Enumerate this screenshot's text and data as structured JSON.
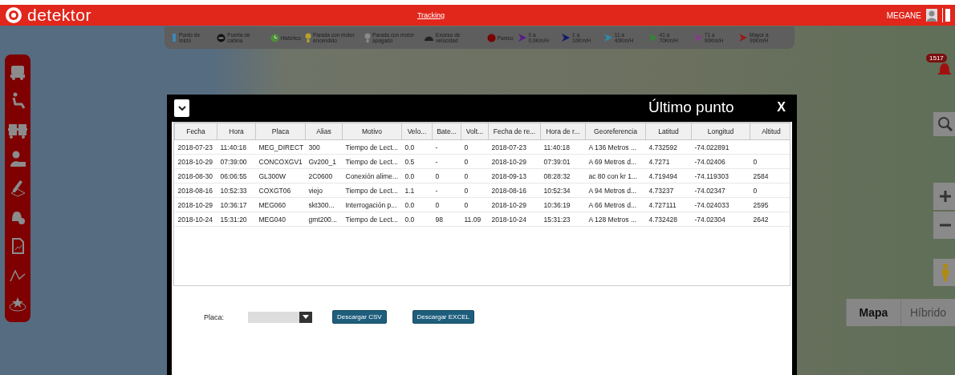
{
  "header": {
    "logo": "detektor",
    "nav_link": "Tracking",
    "user": "MEGANE"
  },
  "legend": [
    {
      "label": "Punto de Inicio",
      "kind": "pin",
      "color": "#3f86b8"
    },
    {
      "label": "Puerta de cabina",
      "kind": "door",
      "color": "#111111"
    },
    {
      "label": "Histórico",
      "kind": "clock",
      "color": "#4f8f3a"
    },
    {
      "label": "Parada con motor encendido",
      "kind": "bulb",
      "color": "#b8a030"
    },
    {
      "label": "Parada con motor apagado",
      "kind": "bulb",
      "color": "#8a8a8a"
    },
    {
      "label": "Exceso de velocidad",
      "kind": "gauge",
      "color": "#222222"
    },
    {
      "label": "Panico",
      "kind": "dot",
      "color": "#7a0000"
    },
    {
      "label": "0 a 0,9Km/H",
      "kind": "arrow",
      "color": "#5a1a8a"
    },
    {
      "label": "1 a 10Km/H",
      "kind": "arrow",
      "color": "#101a6a"
    },
    {
      "label": "11 a 40Km/H",
      "kind": "arrow",
      "color": "#2b8bab"
    },
    {
      "label": "41 a 70Km/H",
      "kind": "arrow",
      "color": "#2f8a2f"
    },
    {
      "label": "71 a 90Km/H",
      "kind": "arrow",
      "color": "#8a3a8a"
    },
    {
      "label": "Mayor a 90Km/H",
      "kind": "arrow",
      "color": "#9a1a1a"
    }
  ],
  "map_controls": {
    "alert_count": "1517",
    "map_types": [
      {
        "label": "Mapa",
        "selected": true
      },
      {
        "label": "Híbrido",
        "selected": false
      }
    ]
  },
  "dialog": {
    "title": "Último punto",
    "close": "X",
    "table": {
      "columns": [
        "Fecha",
        "Hora",
        "Placa",
        "Alias",
        "Motivo",
        "Velo...",
        "Bate...",
        "Volt...",
        "Fecha de re...",
        "Hora de r...",
        "Georeferencia",
        "Latitud",
        "Longitud",
        "Altitud"
      ],
      "rows": [
        [
          "2018-07-23",
          "11:40:18",
          "MEG_DIRECT",
          "300",
          "Tiempo de Lect...",
          "0.0",
          "-",
          "0",
          "2018-07-23",
          "11:40:18",
          "A 136 Metros ...",
          "4.732592",
          "-74.022891",
          null
        ],
        [
          "2018-10-29",
          "07:39:00",
          "CONCOXGV1",
          "Gv200_1",
          "Tiempo de Lect...",
          "0.5",
          "-",
          "0",
          "2018-10-29",
          "07:39:01",
          "A 69 Metros d...",
          "4.7271",
          "-74.02406",
          "0"
        ],
        [
          "2018-08-30",
          "06:06:55",
          "GL300W",
          "2C0600",
          "Conexión alime...",
          "0.0",
          "0",
          "0",
          "2018-09-13",
          "08:28:32",
          "ac 80 con kr 1...",
          "4.719494",
          "-74.119303",
          "2584"
        ],
        [
          "2018-08-16",
          "10:52:33",
          "COXGT06",
          "viejo",
          "Tiempo de Lect...",
          "1.1",
          "-",
          "0",
          "2018-08-16",
          "10:52:34",
          "A 94 Metros d...",
          "4.73237",
          "-74.02347",
          "0"
        ],
        [
          "2018-10-29",
          "10:36:17",
          "MEG060",
          "skt300...",
          "Interrogación p...",
          "0.0",
          "0",
          "0",
          "2018-10-29",
          "10:36:19",
          "A 66 Metros d...",
          "4.727111",
          "-74.024033",
          "2595"
        ],
        [
          "2018-10-24",
          "15:31:20",
          "MEG040",
          "gmt200...",
          "Tiempo de Lect...",
          "0.0",
          "98",
          "11.09",
          "2018-10-24",
          "15:31:23",
          "A 128 Metros ...",
          "4.732428",
          "-74.02304",
          "2642"
        ]
      ]
    },
    "filter": {
      "label": "Placa:"
    },
    "buttons": [
      "Descargar CSV",
      "Descargar EXCEL"
    ]
  }
}
